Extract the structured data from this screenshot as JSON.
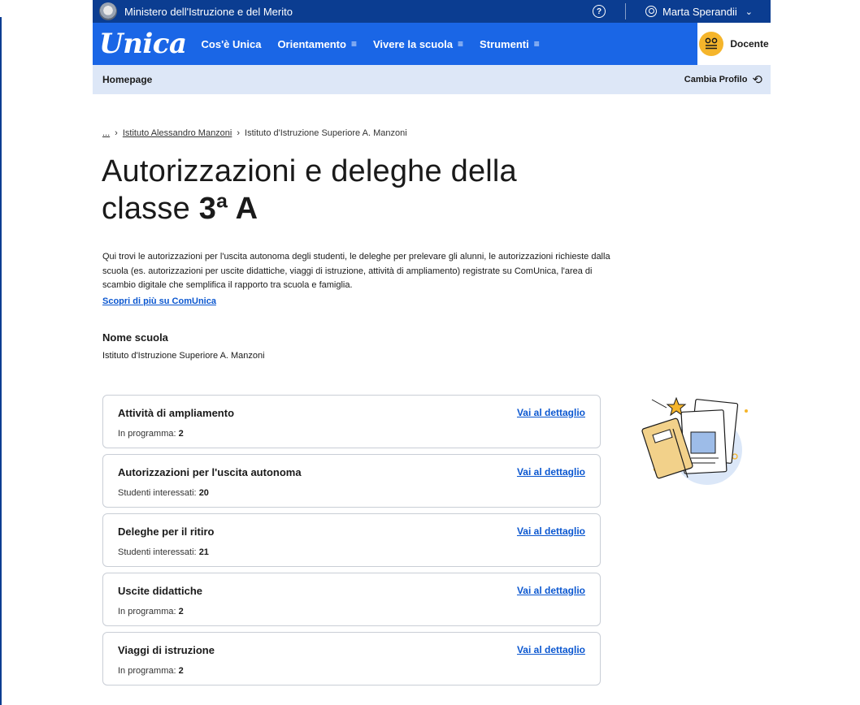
{
  "header": {
    "ministry": "Ministero dell'Istruzione e del Merito",
    "help_symbol": "?",
    "user_name": "Marta Sperandii",
    "user_menu_symbol": "⌄"
  },
  "nav": {
    "logo": "Unica",
    "items": [
      {
        "label": "Cos'è Unica",
        "menu_symbol": ""
      },
      {
        "label": "Orientamento",
        "menu_symbol": "≡"
      },
      {
        "label": "Vivere la scuola",
        "menu_symbol": "≡"
      },
      {
        "label": "Strumenti",
        "menu_symbol": "≡"
      }
    ],
    "profile_label": "Docente"
  },
  "subbar": {
    "home": "Homepage",
    "switch_profile": "Cambia Profilo"
  },
  "breadcrumb": {
    "ellipsis": "...",
    "items": [
      "Istituto Alessandro Manzoni",
      "Istituto d'Istruzione Superiore A. Manzoni"
    ]
  },
  "page": {
    "title_line1": "Autorizzazioni e deleghe della",
    "title_line2_prefix": "classe",
    "title_class": "3ª A",
    "intro": "Qui trovi le autorizzazioni per l'uscita autonoma degli studenti, le deleghe per prelevare gli alunni, le autorizzazioni richieste dalla scuola (es. autorizzazioni per uscite didattiche, viaggi di istruzione, attività di ampliamento) registrate su ComUnica, l'area di scambio digitale che semplifica il rapporto tra scuola e famiglia.",
    "intro_link": "Scopri di più su ComUnica",
    "school_label": "Nome scuola",
    "school_value": "Istituto d'Istruzione Superiore A. Manzoni"
  },
  "cards": [
    {
      "title": "Attività di ampliamento",
      "stat_label": "In programma:",
      "stat_value": "2",
      "link": "Vai al dettaglio"
    },
    {
      "title": "Autorizzazioni per l'uscita autonoma",
      "stat_label": "Studenti interessati:",
      "stat_value": "20",
      "link": "Vai al dettaglio"
    },
    {
      "title": "Deleghe per il ritiro",
      "stat_label": "Studenti interessati:",
      "stat_value": "21",
      "link": "Vai al dettaglio"
    },
    {
      "title": "Uscite didattiche",
      "stat_label": "In programma:",
      "stat_value": "2",
      "link": "Vai al dettaglio"
    },
    {
      "title": "Viaggi di istruzione",
      "stat_label": "In programma:",
      "stat_value": "2",
      "link": "Vai al dettaglio"
    }
  ],
  "colors": {
    "top_bar": "#0b3d91",
    "nav_bar": "#1a66e6",
    "sub_bar": "#dde7f7",
    "link": "#0b57d0",
    "profile_badge": "#f5b52b"
  }
}
